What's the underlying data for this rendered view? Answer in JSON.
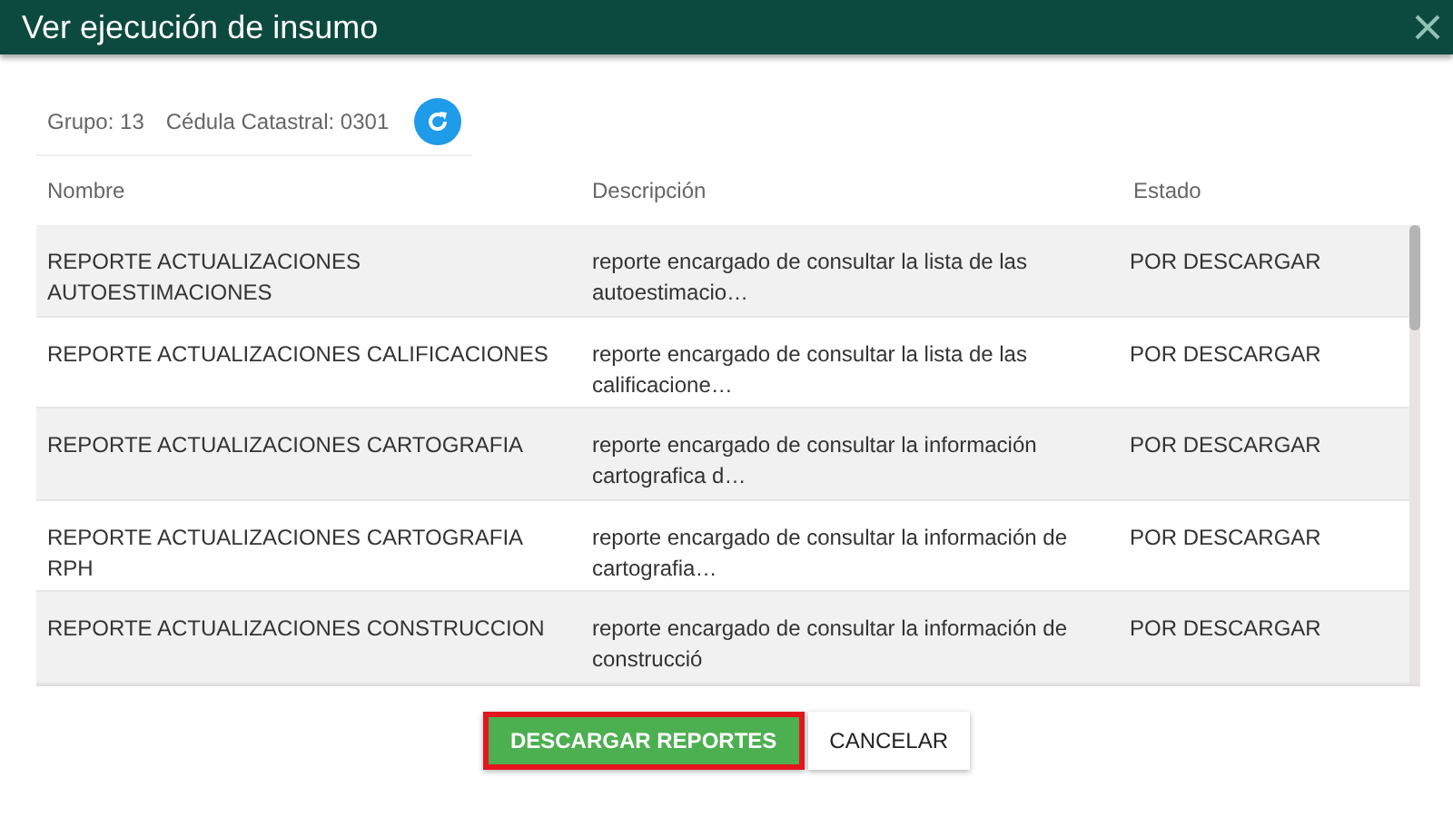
{
  "window": {
    "title": "Ver ejecución de insumo"
  },
  "info": {
    "group": "Grupo: 13",
    "cadastral": "Cédula Catastral: 0301"
  },
  "table": {
    "columns": [
      "Nombre",
      "Descripción",
      "Estado"
    ],
    "rows": [
      {
        "name": "REPORTE ACTUALIZACIONES AUTOESTIMACIONES",
        "description": "reporte encargado de consultar la lista de las autoestimacio…",
        "status": "POR DESCARGAR"
      },
      {
        "name": "REPORTE ACTUALIZACIONES CALIFICACIONES",
        "description": "reporte encargado de consultar la lista de las calificacione…",
        "status": "POR DESCARGAR"
      },
      {
        "name": "REPORTE ACTUALIZACIONES CARTOGRAFIA",
        "description": "reporte encargado de consultar la información cartografica d…",
        "status": "POR DESCARGAR"
      },
      {
        "name": "REPORTE ACTUALIZACIONES CARTOGRAFIA RPH",
        "description": "reporte encargado de consultar la información de cartografia…",
        "status": "POR DESCARGAR"
      },
      {
        "name": "REPORTE ACTUALIZACIONES CONSTRUCCION",
        "description": "reporte encargado de consultar la información de construcció",
        "status": "POR DESCARGAR"
      }
    ]
  },
  "buttons": [
    {
      "label": "DESCARGAR REPORTES",
      "kind": "primary",
      "highlighted": true
    },
    {
      "label": "CANCELAR",
      "kind": "secondary",
      "highlighted": false
    }
  ]
}
